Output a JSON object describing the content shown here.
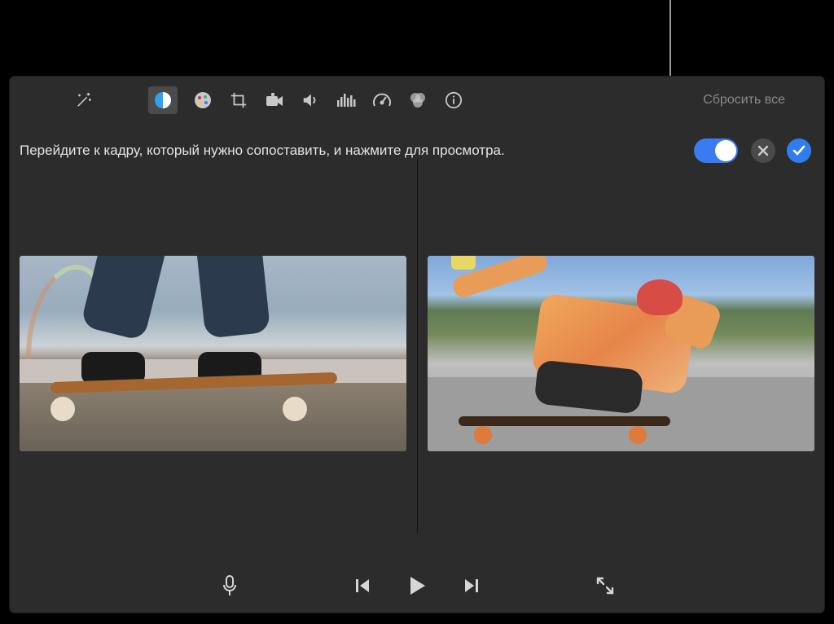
{
  "toolbar": {
    "reset_label": "Сбросить все",
    "icons": {
      "enhance": "magic-wand-icon",
      "skin_tone": "color-balance-icon",
      "color": "color-palette-icon",
      "crop": "crop-icon",
      "stabilize": "camera-icon",
      "volume": "volume-icon",
      "equalizer": "equalizer-icon",
      "speed": "speedometer-icon",
      "filters": "filters-icon",
      "info": "info-icon"
    },
    "active_tool": "skin_tone"
  },
  "hint": {
    "text": "Перейдите к кадру, который нужно сопоставить, и нажмите для просмотра."
  },
  "controls": {
    "toggle_state": "on",
    "cancel": "cancel-icon",
    "apply": "checkmark-icon"
  },
  "viewer": {
    "left_clip": "skateboard-feet-rainbow",
    "right_clip": "skateboarder-crouching-helmet"
  },
  "transport": {
    "voiceover": "microphone-icon",
    "prev": "previous-frame-icon",
    "play": "play-icon",
    "next": "next-frame-icon",
    "fullscreen": "fullscreen-icon"
  }
}
